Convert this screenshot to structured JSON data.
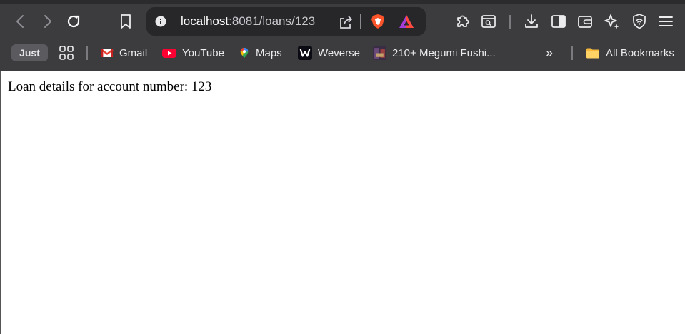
{
  "address_bar": {
    "host": "localhost",
    "path": ":8081/loans/123"
  },
  "bookmarks": {
    "just_label": "Just",
    "items": [
      {
        "label": "Gmail",
        "icon": "gmail-icon"
      },
      {
        "label": "YouTube",
        "icon": "youtube-icon"
      },
      {
        "label": "Maps",
        "icon": "maps-icon"
      },
      {
        "label": "Weverse",
        "icon": "weverse-icon"
      },
      {
        "label": "210+ Megumi Fushi...",
        "icon": "thumbnail-icon"
      }
    ],
    "overflow_label": "»",
    "all_bookmarks_label": "All Bookmarks"
  },
  "page": {
    "text": "Loan details for account number: 123"
  },
  "colors": {
    "chrome_bg": "#3c3c3f",
    "omnibox_bg": "#27272a",
    "brave_orange": "#fb542b",
    "page_bg": "#ffffff"
  }
}
